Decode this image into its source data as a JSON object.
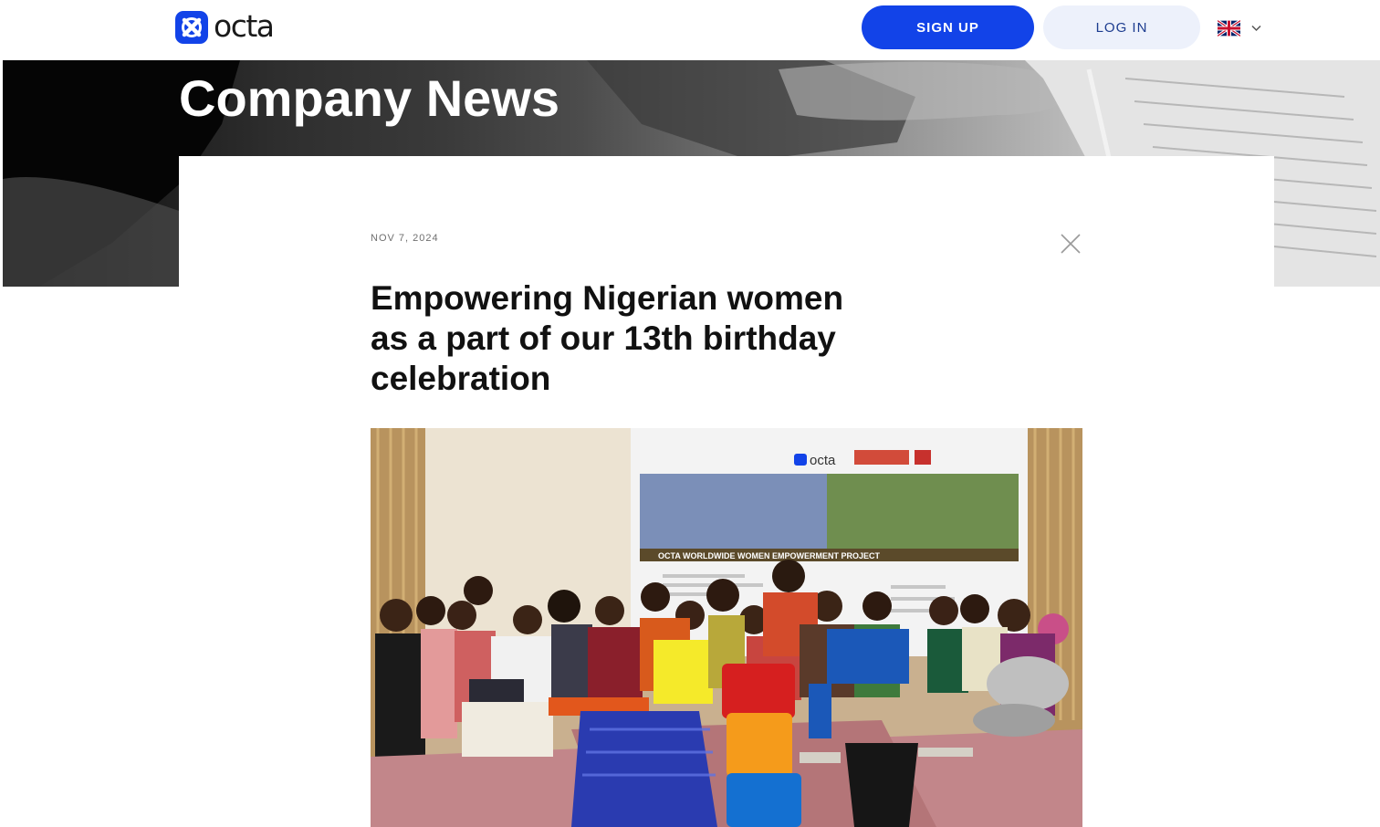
{
  "header": {
    "brand": "octa",
    "signup_label": "SIGN UP",
    "login_label": "LOG IN",
    "language_icon": "uk-flag-icon"
  },
  "hero": {
    "title": "Company News"
  },
  "article": {
    "date": "NOV 7, 2024",
    "title": "Empowering Nigerian women as a part of our 13th birthday celebration",
    "photo": {
      "banner_brand": "octa",
      "banner_caption": "OCTA WORLDWIDE WOMEN EMPOWERMENT PROJECT"
    }
  },
  "colors": {
    "brand_blue": "#1243e8",
    "login_bg": "#edf1fb",
    "title_text": "#111111"
  }
}
